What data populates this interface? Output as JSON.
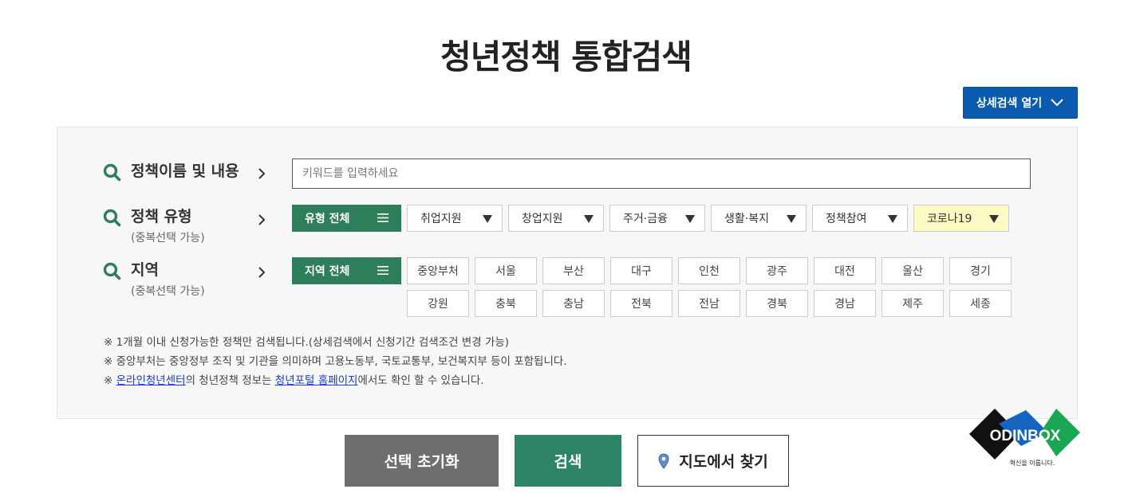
{
  "title": "청년정책 통합검색",
  "advanced_search": {
    "label": "상세검색 열기"
  },
  "keyword": {
    "label": "정책이름 및 내용",
    "placeholder": "키워드를 입력하세요"
  },
  "policy_type": {
    "label": "정책 유형",
    "sub": "(중복선택 가능)",
    "all_label": "유형 전체",
    "items": [
      "취업지원",
      "창업지원",
      "주거·금융",
      "생활·복지",
      "정책참여",
      "코로나19"
    ]
  },
  "region": {
    "label": "지역",
    "sub": "(중복선택 가능)",
    "all_label": "지역 전체",
    "row1": [
      "중앙부처",
      "서울",
      "부산",
      "대구",
      "인천",
      "광주",
      "대전",
      "울산",
      "경기"
    ],
    "row2": [
      "강원",
      "충북",
      "충남",
      "전북",
      "전남",
      "경북",
      "경남",
      "제주",
      "세종"
    ]
  },
  "notes": {
    "line1": "※ 1개월 이내 신청가능한 정책만 검색됩니다.(상세검색에서 신청기간 검색조건 변경 가능)",
    "line2": "※ 중앙부처는 중앙정부 조직 및 기관을 의미하며 고용노동부, 국토교통부, 보건복지부 등이 포함됩니다.",
    "line3_prefix": "※ ",
    "line3_link1": "온라인청년센터",
    "line3_mid": "의 청년정책 정보는 ",
    "line3_link2": "청년포털 홈페이지",
    "line3_suffix": "에서도 확인 할 수 있습니다."
  },
  "actions": {
    "reset": "선택 초기화",
    "search": "검색",
    "map": "지도에서 찾기"
  },
  "logo": {
    "name": "ODINBOX",
    "tagline": "혁신을 이룹니다."
  },
  "colors": {
    "accent_green": "#2e7d5b",
    "accent_blue": "#0a5bb0",
    "covid_highlight": "#fdfbc4",
    "reset_gray": "#6e6e6e"
  }
}
